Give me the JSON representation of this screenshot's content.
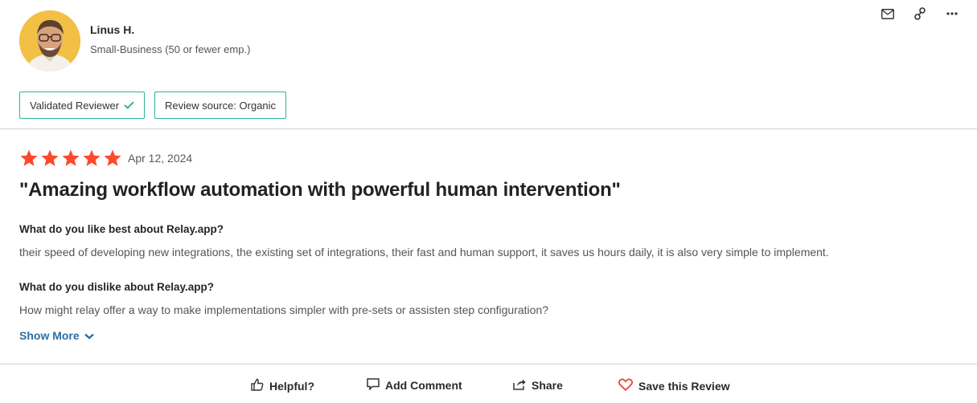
{
  "reviewer": {
    "name": "Linus H.",
    "segment": "Small-Business (50 or fewer emp.)",
    "avatar_bg": "#f2c044"
  },
  "top_actions": [
    {
      "icon": "envelope-icon"
    },
    {
      "icon": "link-icon"
    },
    {
      "icon": "more-icon"
    }
  ],
  "badges": {
    "validated": "Validated Reviewer",
    "source": "Review source: Organic"
  },
  "rating": {
    "stars": 5,
    "out_of": 5,
    "star_color": "#ff492c",
    "date": "Apr 12, 2024"
  },
  "review": {
    "title": "\"Amazing workflow automation with powerful human intervention\"",
    "q1": "What do you like best about Relay.app?",
    "a1": "their speed of developing new integrations, the existing set of integrations, their fast and human support, it saves us hours daily, it is also very simple to implement.",
    "q2": "What do you dislike about Relay.app?",
    "a2": "How might relay offer a way to make implementations simpler with pre-sets or assisten step configuration?",
    "show_more": "Show More"
  },
  "footer": {
    "helpful": "Helpful?",
    "comment": "Add Comment",
    "share": "Share",
    "save": "Save this Review"
  },
  "colors": {
    "accent_green": "#2fb49a",
    "link_blue": "#2c6ea3",
    "heart_red": "#e8473a"
  }
}
